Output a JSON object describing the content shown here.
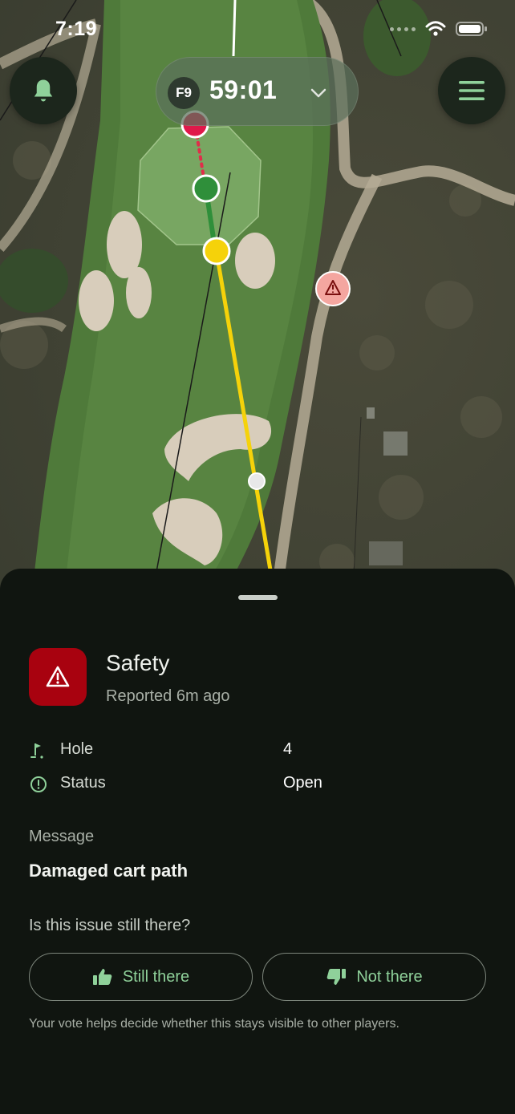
{
  "status_bar": {
    "time": "7:19",
    "icons": [
      "signal-dots-icon",
      "wifi-icon",
      "battery-icon"
    ]
  },
  "map_controls": {
    "bell_icon": "bell-icon",
    "menu_icon": "hamburger-menu-icon",
    "timer": {
      "badge": "F9",
      "value": "59:01",
      "chevron_icon": "chevron-down-icon"
    }
  },
  "map": {
    "markers": [
      "pin-red",
      "target-green",
      "ball-yellow",
      "hazard-warning",
      "distance-point"
    ],
    "shot_line_color": "#f5d20a",
    "green_segment_color": "#2f8f3a",
    "hazard_color": "#f4a6a0"
  },
  "issue": {
    "category": "Safety",
    "reported": "Reported 6m ago",
    "accent_color": "#a8020f",
    "details": {
      "hole_label": "Hole",
      "hole_value": "4",
      "status_label": "Status",
      "status_value": "Open"
    },
    "message_label": "Message",
    "message_text": "Damaged cart path",
    "question": "Is this issue still there?",
    "still_there_label": "Still there",
    "not_there_label": "Not there",
    "vote_note": "Your vote helps decide whether this stays visible to other players."
  }
}
